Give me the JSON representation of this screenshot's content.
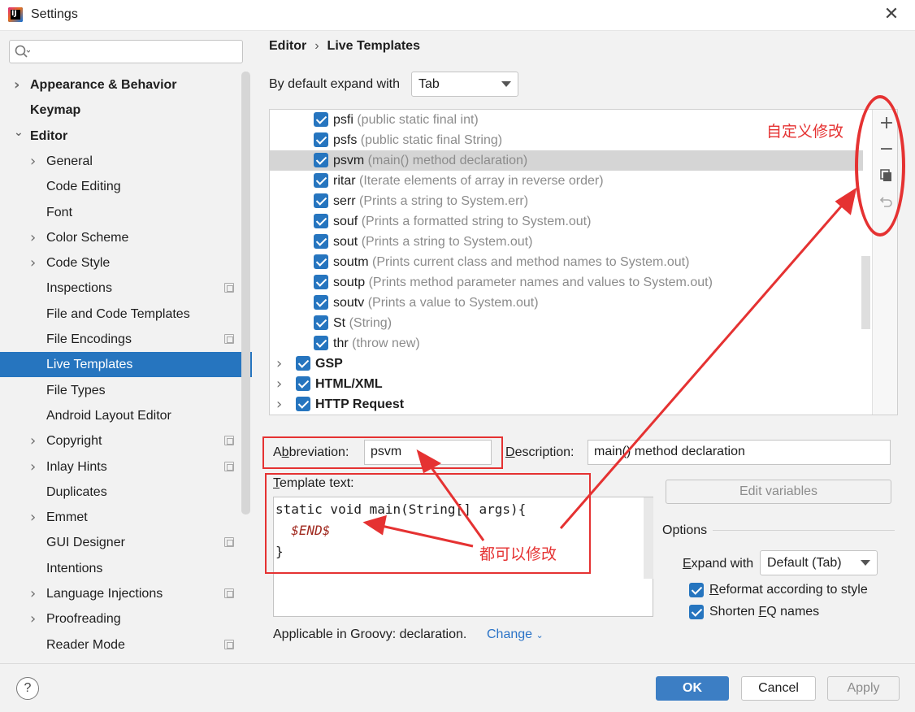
{
  "window": {
    "title": "Settings",
    "app_icon": "intellij-logo",
    "app_icon_text": "IJ"
  },
  "search": {
    "placeholder": ""
  },
  "sidebar": {
    "items": [
      {
        "label": "Appearance & Behavior",
        "bold": true,
        "chevron": true
      },
      {
        "label": "Keymap",
        "bold": true,
        "chevron": false
      },
      {
        "label": "Editor",
        "bold": true,
        "chevron": true,
        "expanded": true
      },
      {
        "label": "General",
        "chevron": true
      },
      {
        "label": "Code Editing",
        "chevron": false
      },
      {
        "label": "Font",
        "chevron": false
      },
      {
        "label": "Color Scheme",
        "chevron": true
      },
      {
        "label": "Code Style",
        "chevron": true
      },
      {
        "label": "Inspections",
        "badge": true
      },
      {
        "label": "File and Code Templates",
        "badge": false
      },
      {
        "label": "File Encodings",
        "badge": true
      },
      {
        "label": "Live Templates",
        "selected": true
      },
      {
        "label": "File Types"
      },
      {
        "label": "Android Layout Editor"
      },
      {
        "label": "Copyright",
        "chevron": true,
        "badge": true
      },
      {
        "label": "Inlay Hints",
        "chevron": true,
        "badge": true
      },
      {
        "label": "Duplicates"
      },
      {
        "label": "Emmet",
        "chevron": true
      },
      {
        "label": "GUI Designer",
        "badge": true
      },
      {
        "label": "Intentions"
      },
      {
        "label": "Language Injections",
        "chevron": true,
        "badge": true
      },
      {
        "label": "Proofreading",
        "chevron": true
      },
      {
        "label": "Reader Mode",
        "badge": true
      }
    ]
  },
  "breadcrumb": {
    "parent": "Editor",
    "separator": "›",
    "current": "Live Templates"
  },
  "expand_default": {
    "label": "By default expand with",
    "value": "Tab"
  },
  "templates": [
    {
      "abbr": "psfi",
      "desc": "(public static final int)"
    },
    {
      "abbr": "psfs",
      "desc": "(public static final String)"
    },
    {
      "abbr": "psvm",
      "desc": "(main() method declaration)",
      "selected": true
    },
    {
      "abbr": "ritar",
      "desc": "(Iterate elements of array in reverse order)"
    },
    {
      "abbr": "serr",
      "desc": "(Prints a string to System.err)"
    },
    {
      "abbr": "souf",
      "desc": "(Prints a formatted string to System.out)"
    },
    {
      "abbr": "sout",
      "desc": "(Prints a string to System.out)"
    },
    {
      "abbr": "soutm",
      "desc": "(Prints current class and method names to System.out)"
    },
    {
      "abbr": "soutp",
      "desc": "(Prints method parameter names and values to System.out)"
    },
    {
      "abbr": "soutv",
      "desc": "(Prints a value to System.out)"
    },
    {
      "abbr": "St",
      "desc": "(String)"
    },
    {
      "abbr": "thr",
      "desc": "(throw new)"
    }
  ],
  "template_groups": [
    {
      "name": "GSP"
    },
    {
      "name": "HTML/XML"
    },
    {
      "name": "HTTP Request"
    }
  ],
  "toolbar": {
    "add": "+",
    "remove": "−",
    "copy": "copy-icon",
    "restore": "undo-icon"
  },
  "details": {
    "abbreviation_label_pre": "A",
    "abbreviation_label_mn": "b",
    "abbreviation_label_post": "breviation:",
    "abbreviation_value": "psvm",
    "description_label_pre": "",
    "description_label_mn": "D",
    "description_label_post": "escription:",
    "description_value": "main() method declaration",
    "template_text_label_mn": "T",
    "template_text_label_post": "emplate text:",
    "code_line1": "static void main(String[] args){",
    "code_line2": "  $END$",
    "code_line3": "}",
    "edit_variables": "Edit variables",
    "applicable": "Applicable in Groovy: declaration.",
    "change_link": "Change"
  },
  "options": {
    "title": "Options",
    "expand_label_mn": "E",
    "expand_label_post": "xpand with",
    "expand_value": "Default (Tab)",
    "reformat_mn": "R",
    "reformat_post": "eformat according to style",
    "shorten_pre": "Shorten ",
    "shorten_mn": "F",
    "shorten_post": "Q names"
  },
  "buttons": {
    "ok": "OK",
    "cancel": "Cancel",
    "apply": "Apply",
    "help": "?"
  },
  "annotations": {
    "custom_modify": "自定义修改",
    "all_modifiable": "都可以修改",
    "color": "#e53232"
  }
}
